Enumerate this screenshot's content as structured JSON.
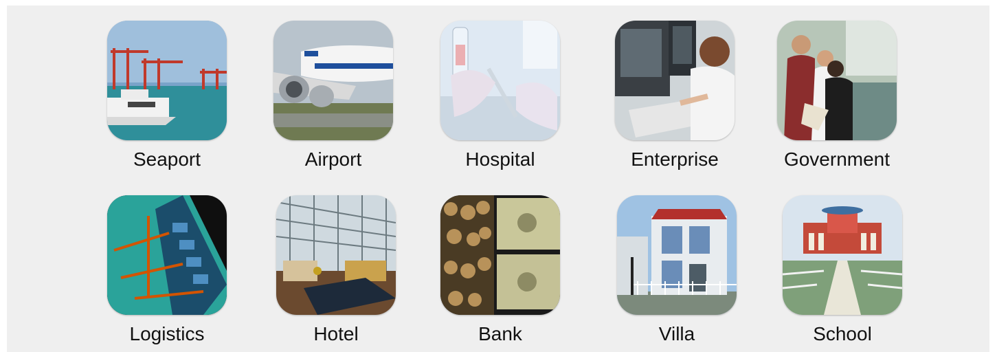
{
  "tiles": [
    {
      "label": "Seaport",
      "icon": "seaport-image"
    },
    {
      "label": "Airport",
      "icon": "airport-image"
    },
    {
      "label": "Hospital",
      "icon": "hospital-image"
    },
    {
      "label": "Enterprise",
      "icon": "enterprise-image"
    },
    {
      "label": "Government",
      "icon": "government-image"
    },
    {
      "label": "Logistics",
      "icon": "logistics-image"
    },
    {
      "label": "Hotel",
      "icon": "hotel-image"
    },
    {
      "label": "Bank",
      "icon": "bank-image"
    },
    {
      "label": "Villa",
      "icon": "villa-image"
    },
    {
      "label": "School",
      "icon": "school-image"
    }
  ]
}
